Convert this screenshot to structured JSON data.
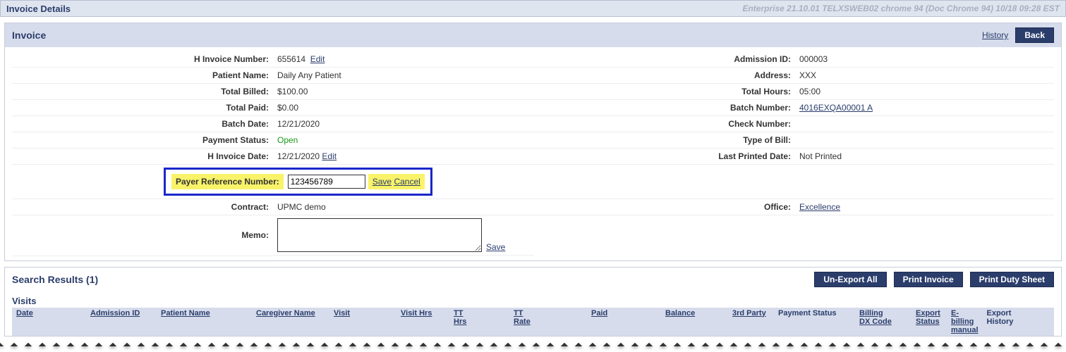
{
  "top": {
    "title": "Invoice Details",
    "env": "Enterprise 21.10.01 TELXSWEB02 chrome 94 (Doc Chrome 94) 10/18 09:28 EST"
  },
  "panel": {
    "title": "Invoice",
    "history": "History",
    "back": "Back"
  },
  "invoice": {
    "row1": {
      "l": "H  Invoice Number:",
      "v": "655614",
      "edit": "Edit",
      "l2": "Admission ID:",
      "v2": "000003"
    },
    "row2": {
      "l": "Patient Name:",
      "v": "Daily Any Patient",
      "l2": "Address:",
      "v2": "XXX"
    },
    "row3": {
      "l": "Total Billed:",
      "v": "$100.00",
      "l2": "Total Hours:",
      "v2": "05:00"
    },
    "row4": {
      "l": "Total Paid:",
      "v": "$0.00",
      "l2": "Batch Number:",
      "v2": "4016EXQA00001 A"
    },
    "row5": {
      "l": "Batch Date:",
      "v": "12/21/2020",
      "l2": "Check Number:",
      "v2": ""
    },
    "row6": {
      "l": "Payment Status:",
      "v": "Open",
      "l2": "Type of Bill:",
      "v2": ""
    },
    "row7": {
      "l": "H  Invoice Date:",
      "v": "12/21/2020",
      "edit": "Edit",
      "l2": "Last Printed Date:",
      "v2": "Not Printed"
    },
    "row8": {
      "l": "Payer Reference Number:",
      "input": "123456789",
      "save": "Save",
      "cancel": "Cancel"
    },
    "row9": {
      "l": "Contract:",
      "v": "UPMC demo",
      "l2": "Office:",
      "v2": "Excellence"
    },
    "row10": {
      "l": "Memo:",
      "v": "",
      "save": "Save"
    }
  },
  "results": {
    "title": "Search Results  (1)",
    "unexport": "Un-Export All",
    "print_invoice": "Print Invoice",
    "print_duty": "Print Duty Sheet",
    "visits": "Visits",
    "columns": {
      "date": "Date",
      "admission": "Admission ID",
      "patient": "Patient Name",
      "caregiver": "Caregiver Name",
      "visit": "Visit",
      "visit_hrs": "Visit Hrs",
      "tt_hrs": "TT\nHrs",
      "tt_rate": "TT\nRate",
      "paid": "Paid",
      "balance": "Balance",
      "third_party": "3rd Party",
      "payment_status": "Payment Status",
      "billing_dx": "Billing\nDX Code",
      "export_status": "Export\nStatus",
      "ebilling": "E-\nbilling\nmanual",
      "export_history": "Export\nHistory"
    }
  }
}
